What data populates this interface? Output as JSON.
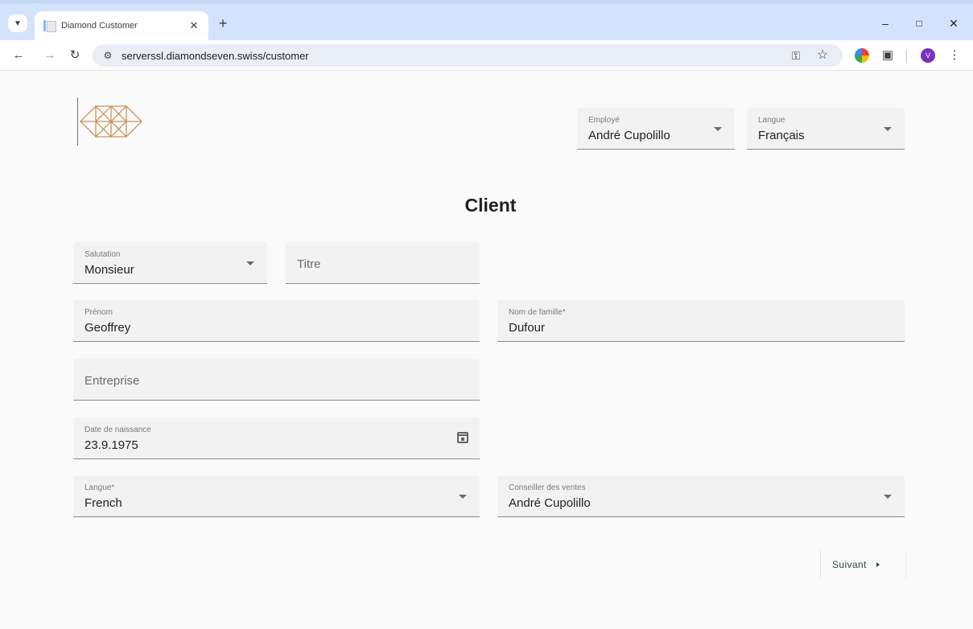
{
  "browser": {
    "tab_title": "Diamond Customer",
    "tab_close": "✕",
    "new_tab": "+",
    "url": "serverssl.diamondseven.swiss/customer",
    "profile_initial": "V",
    "window_controls": {
      "minimize": "–",
      "maximize": "□",
      "close": "✕"
    }
  },
  "header": {
    "employee": {
      "label": "Employé",
      "value": "André Cupolillo"
    },
    "language": {
      "label": "Langue",
      "value": "Français"
    }
  },
  "page": {
    "title": "Client"
  },
  "form": {
    "salutation": {
      "label": "Salutation",
      "value": "Monsieur"
    },
    "title": {
      "placeholder": "Titre"
    },
    "first_name": {
      "label": "Prénom",
      "value": "Geoffrey"
    },
    "last_name": {
      "label": "Nom de famille*",
      "value": "Dufour"
    },
    "company": {
      "placeholder": "Entreprise"
    },
    "birth_date": {
      "label": "Date de naissance",
      "value": "23.9.1975"
    },
    "language": {
      "label": "Langue*",
      "value": "French"
    },
    "sales_advisor": {
      "label": "Conseiller des ventes",
      "value": "André Cupolillo"
    }
  },
  "actions": {
    "next_label": "Suivant"
  },
  "colors": {
    "field_bg": "#f2f2f2",
    "page_bg": "#fafafa",
    "tabbar_bg": "#d3e3fd",
    "logo_gold": "#c9955c",
    "next_text": "#2e4a40"
  }
}
